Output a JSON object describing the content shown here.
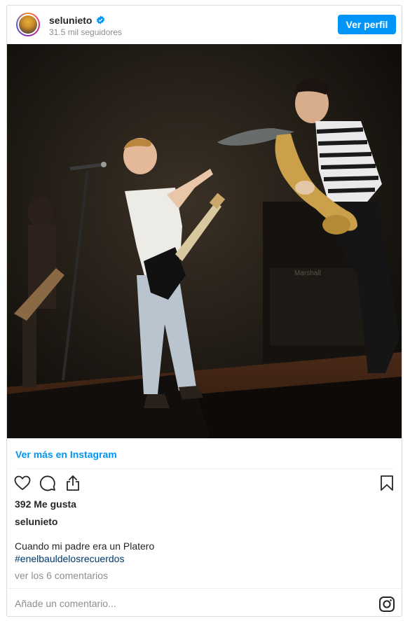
{
  "header": {
    "username": "selunieto",
    "followers": "31.5 mil seguidores",
    "profile_button": "Ver perfil"
  },
  "post": {
    "more_link": "Ver más en Instagram",
    "likes": "392 Me gusta",
    "owner": "selunieto",
    "caption": "Cuando mi padre era un Platero",
    "hashtag": "#enelbauldelosrecuerdos",
    "comments_link": "ver los 6 comentarios",
    "comment_placeholder": "Añade un comentario..."
  },
  "icons": {
    "like": "heart-icon",
    "comment": "comment-icon",
    "share": "share-icon",
    "save": "bookmark-icon",
    "instagram": "instagram-icon",
    "verified": "verified-badge-icon"
  },
  "colors": {
    "accent": "#0095f6",
    "hashtag": "#00376b",
    "muted": "#8e8e8e"
  }
}
